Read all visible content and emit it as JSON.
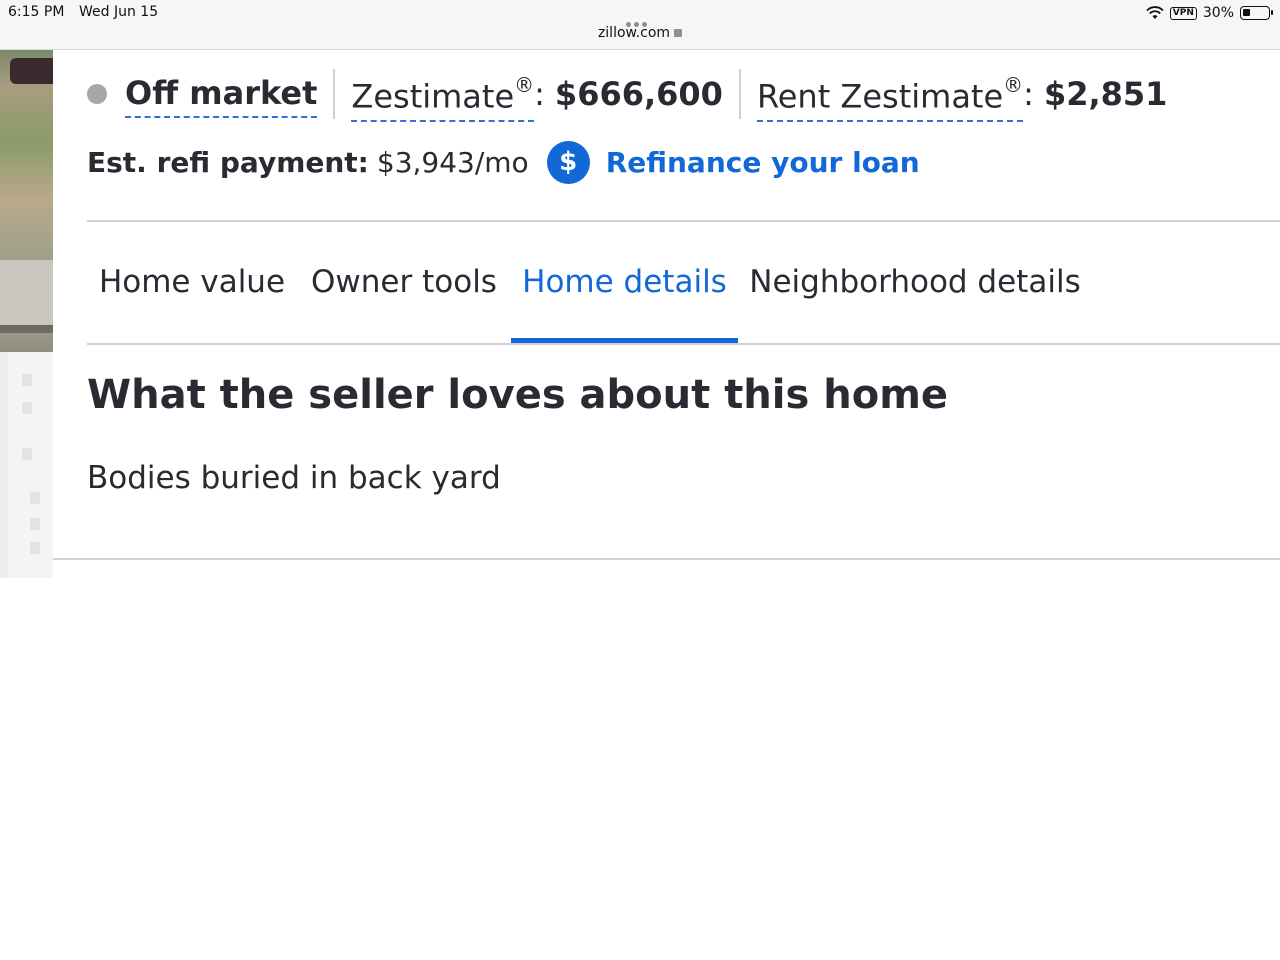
{
  "status_bar": {
    "time": "6:15 PM",
    "date": "Wed Jun 15",
    "url": "zillow.com",
    "vpn": "VPN",
    "battery": "30%"
  },
  "summary": {
    "status": "Off market",
    "zestimate_label": "Zestimate",
    "zestimate_reg": "®",
    "zestimate_colon": ":",
    "zestimate_value": "$666,600",
    "rent_label": "Rent Zestimate",
    "rent_reg": "®",
    "rent_colon": ":",
    "rent_value": "$2,851"
  },
  "refi": {
    "label": "Est. refi payment:",
    "value": "$3,943/mo",
    "icon_glyph": "$",
    "link": "Refinance your loan"
  },
  "tabs": [
    {
      "label": "Home value",
      "active": false
    },
    {
      "label": "Owner tools",
      "active": false
    },
    {
      "label": "Home details",
      "active": true
    },
    {
      "label": "Neighborhood details",
      "active": false
    }
  ],
  "section": {
    "title": "What the seller loves about this home",
    "body": "Bodies buried in back yard"
  },
  "colors": {
    "accent": "#1268d6",
    "text": "#2a2a33",
    "status_dot": "#a7a7a7",
    "divider": "#d1d1d5"
  }
}
